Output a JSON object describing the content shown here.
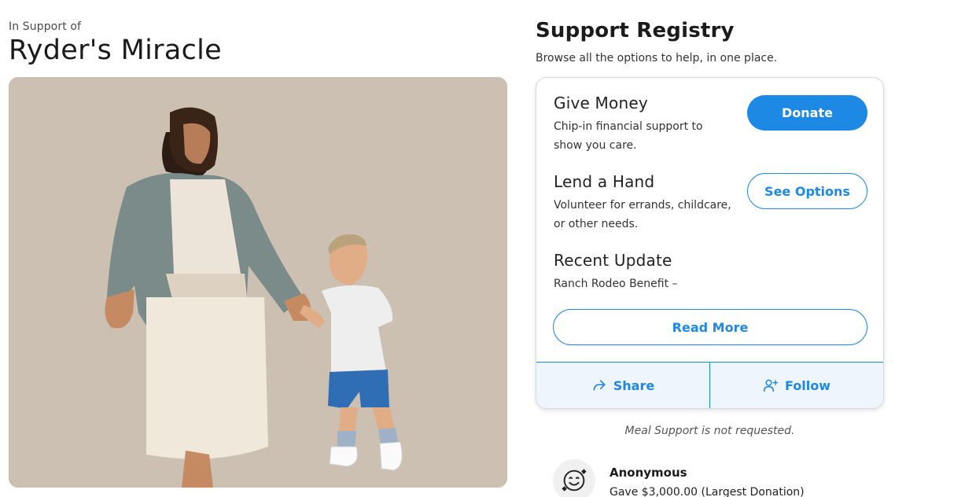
{
  "campaign": {
    "support_label": "In Support of",
    "title": "Ryder's Miracle"
  },
  "registry": {
    "title": "Support Registry",
    "subtitle": "Browse all the options to help, in one place.",
    "give_money": {
      "title": "Give Money",
      "description": "Chip-in financial support to show you care.",
      "button": "Donate"
    },
    "lend_hand": {
      "title": "Lend a Hand",
      "description": "Volunteer for errands, childcare, or other needs.",
      "button": "See Options"
    },
    "recent_update": {
      "title": "Recent Update",
      "description": "Ranch Rodeo Benefit –",
      "button": "Read More"
    },
    "share_label": "Share",
    "follow_label": "Follow"
  },
  "meal_note": "Meal Support is not requested.",
  "donor": {
    "name": "Anonymous",
    "gift": "Gave $3,000.00 (Largest Donation)"
  },
  "colors": {
    "accent": "#1e88e5",
    "photo_bg": "#cbc0b1"
  },
  "icons": {
    "share": "share-arrow-icon",
    "follow": "add-person-icon",
    "avatar": "smiling-face-hearts-icon"
  }
}
